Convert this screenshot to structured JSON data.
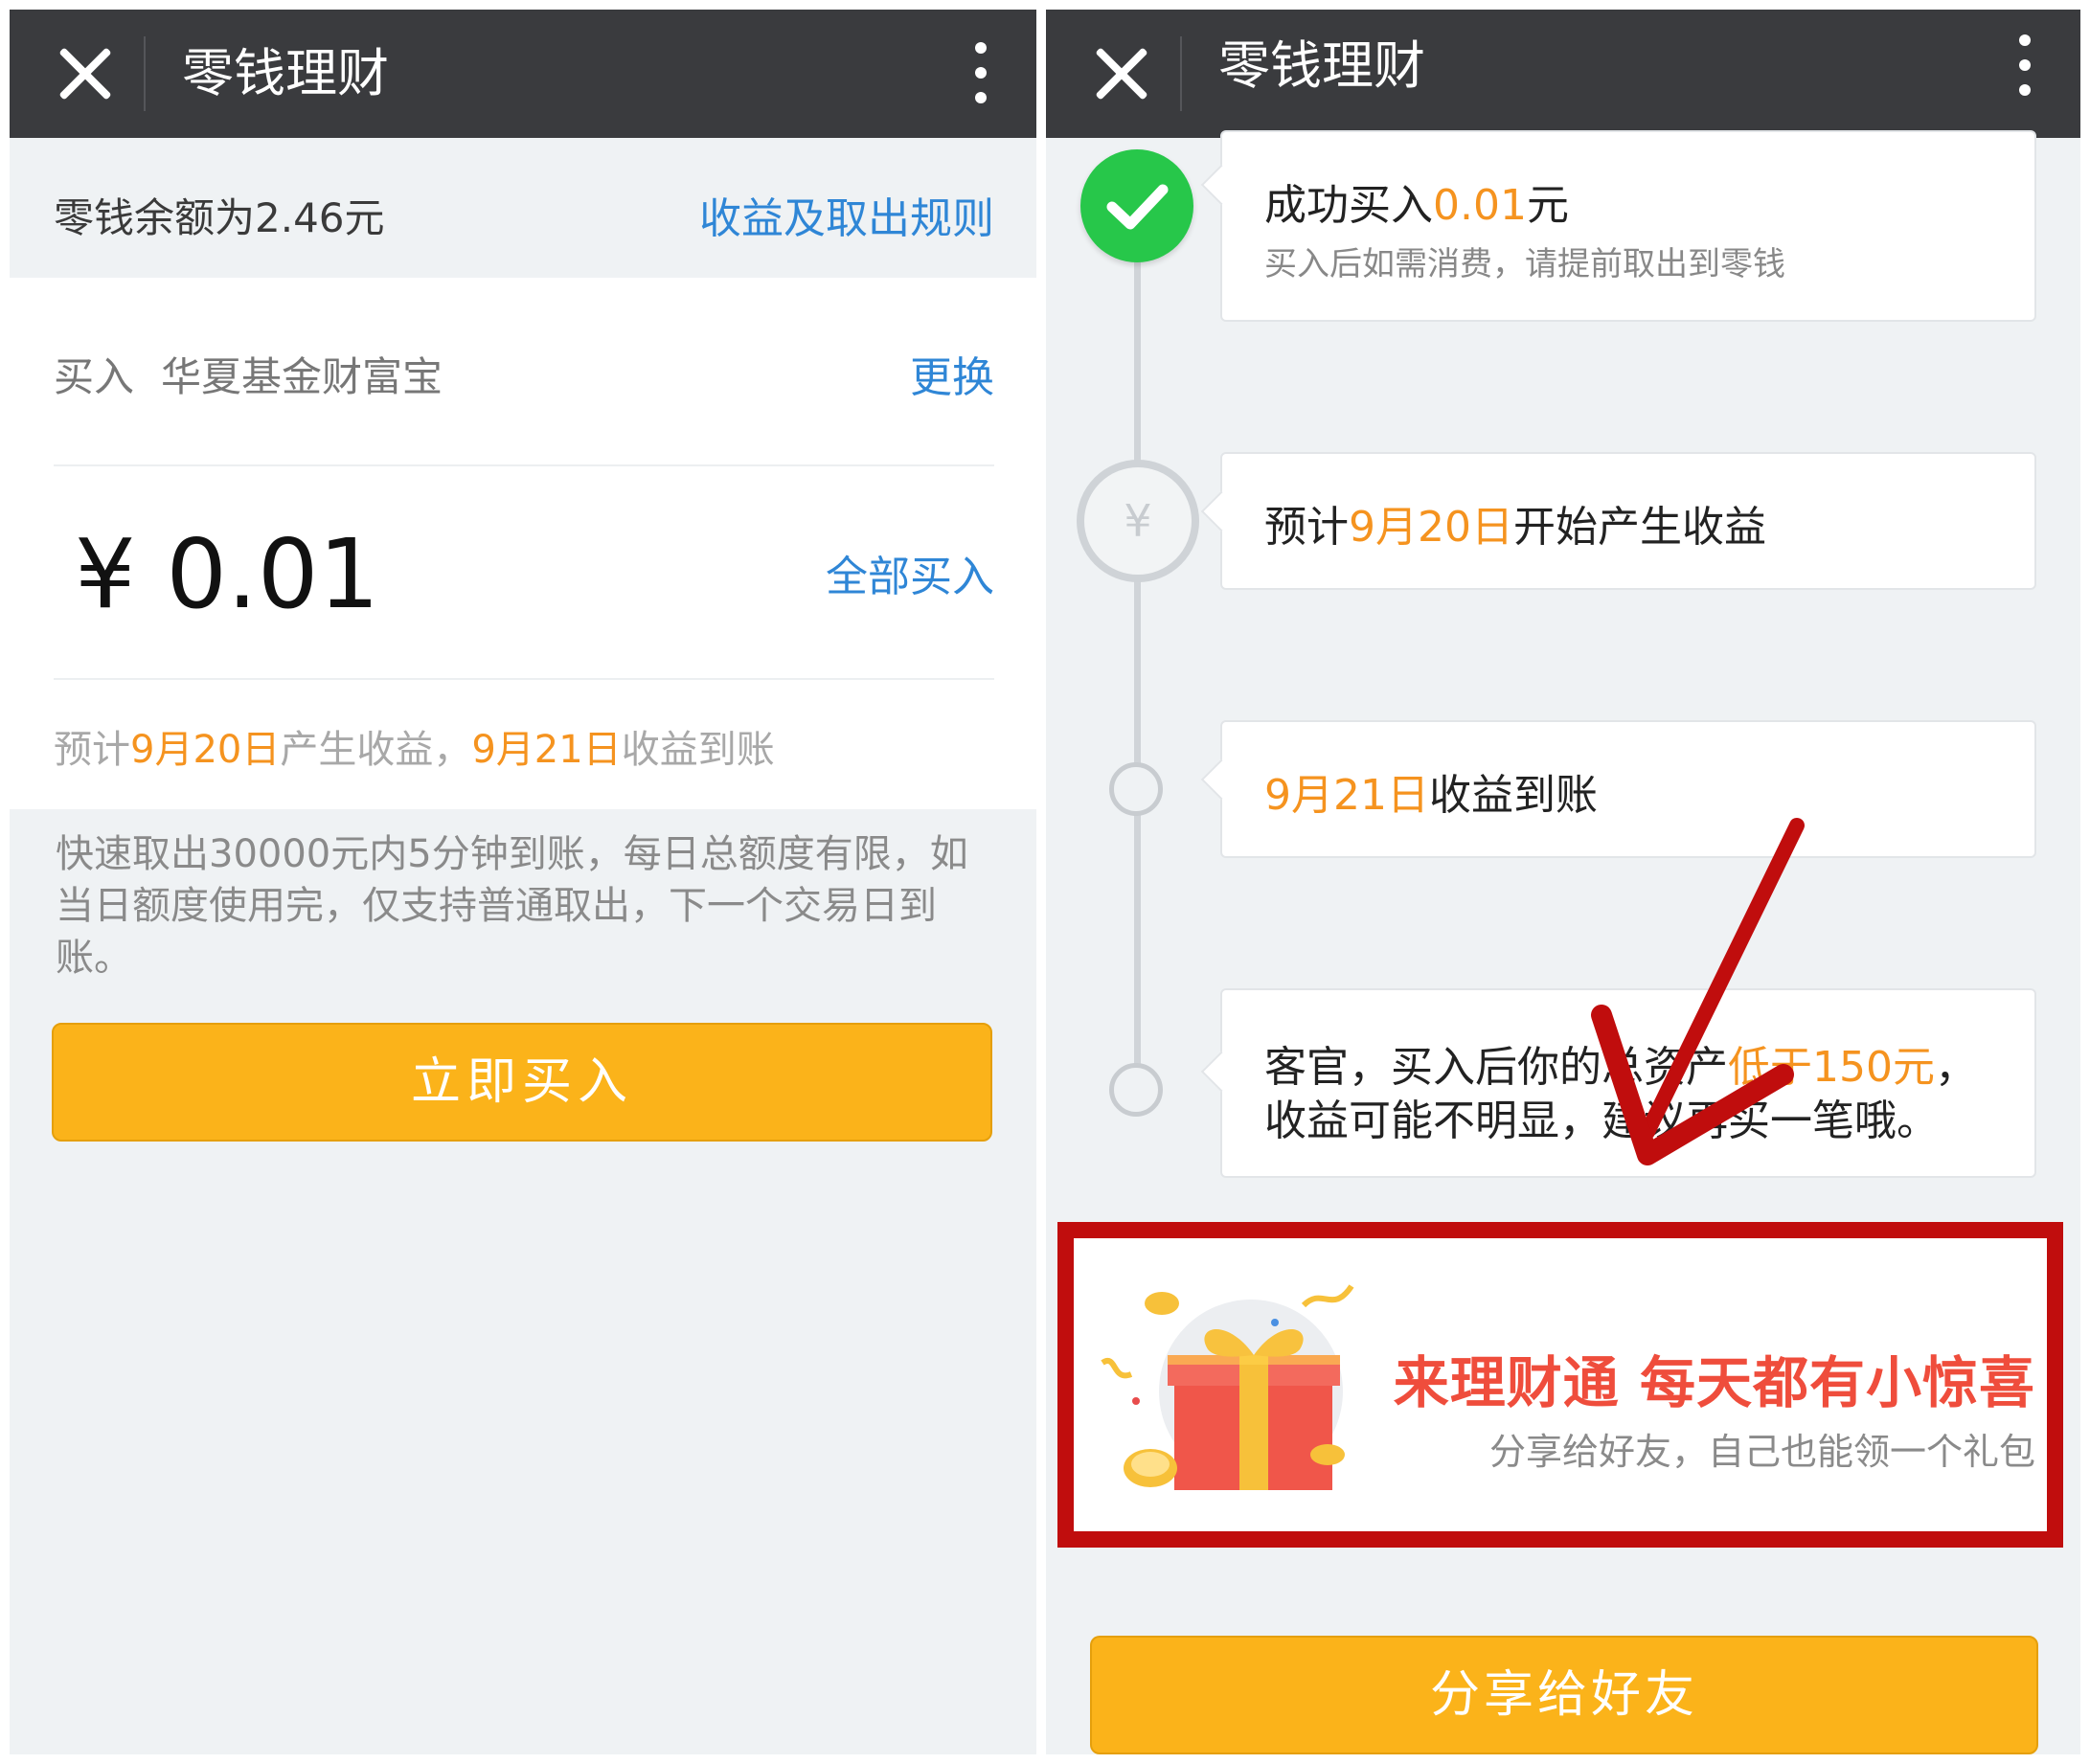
{
  "left": {
    "title": "零钱理财",
    "balance": "零钱余额为2.46元",
    "rules_link": "收益及取出规则",
    "buy_label": "买入",
    "fund_name": "华夏基金财富宝",
    "change_link": "更换",
    "amount": "¥ 0.01",
    "all_buy_link": "全部买入",
    "estimate": {
      "p1": "预计",
      "d1": "9月20日",
      "p2": "产生收益，",
      "d2": "9月21日",
      "p3": "收益到账"
    },
    "fast_note": "快速取出30000元内5分钟到账，每日总额度有限，如当日额度使用完，仅支持普通取出，下一个交易日到账。",
    "buy_button": "立即买入"
  },
  "right": {
    "title": "零钱理财",
    "step1": {
      "prefix": "成功买入",
      "amount": "0.01",
      "suffix": "元",
      "sub": "买入后如需消费，请提前取出到零钱"
    },
    "step2": {
      "yen": "¥",
      "prefix": "预计",
      "date": "9月20日",
      "suffix": "开始产生收益"
    },
    "step3": {
      "date": "9月21日",
      "suffix": "收益到账"
    },
    "step4": {
      "line1_prefix": "客官，买入后你的总资产",
      "line1_highlight": "低于150元",
      "line1_suffix": "，",
      "line2": "收益可能不明显，建议再买一笔哦。"
    },
    "promo": {
      "title": "来理财通 每天都有小惊喜",
      "subtitle": "分享给好友，自己也能领一个礼包"
    },
    "share_button": "分享给好友"
  },
  "colors": {
    "topbar": "#3a3b3e",
    "accent_link": "#2f86d6",
    "highlight": "#f5931f",
    "button": "#fbb31a",
    "success": "#27c74a",
    "annotation_red": "#c00d0d"
  },
  "icons": [
    "close-icon",
    "more-icon",
    "check-icon",
    "yen-icon",
    "gift-icon",
    "annotation-arrow"
  ]
}
